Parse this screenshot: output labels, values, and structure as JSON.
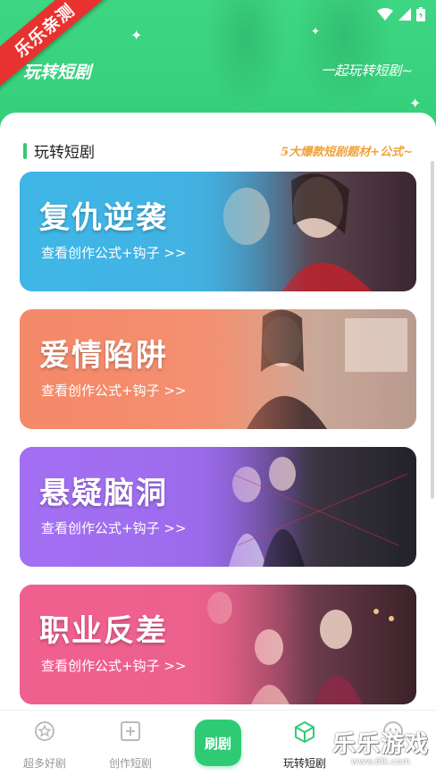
{
  "header": {
    "ribbon": "乐乐亲测",
    "title": "玩转短剧",
    "slogan": "一起玩转短剧~"
  },
  "section": {
    "title": "玩转短剧",
    "subtitle": "5大爆款短剧题材+公式~"
  },
  "cards": [
    {
      "title": "复仇逆袭",
      "link": "查看创作公式+钩子 >>",
      "color": "#3fb6e6"
    },
    {
      "title": "爱情陷阱",
      "link": "查看创作公式+钩子 >>",
      "color": "#f08a6a"
    },
    {
      "title": "悬疑脑洞",
      "link": "查看创作公式+钩子 >>",
      "color": "#9c6cf0"
    },
    {
      "title": "职业反差",
      "link": "查看创作公式+钩子 >>",
      "color": "#ef5d8e"
    }
  ],
  "tabbar": {
    "tabs": [
      {
        "label": "超多好剧",
        "icon": "film-star-icon"
      },
      {
        "label": "创作短剧",
        "icon": "add-square-icon"
      },
      {
        "label": "刷剧",
        "icon": "center-play-button"
      },
      {
        "label": "玩转短剧",
        "icon": "cube-icon",
        "active": true
      },
      {
        "label": "",
        "icon": "profile-icon"
      }
    ]
  },
  "watermark": {
    "title": "乐乐游戏",
    "url": "www.6lk.com"
  },
  "colors": {
    "accent": "#2ecb74",
    "header_bg": "#3ed682",
    "subtitle_orange": "#f0a23a"
  }
}
